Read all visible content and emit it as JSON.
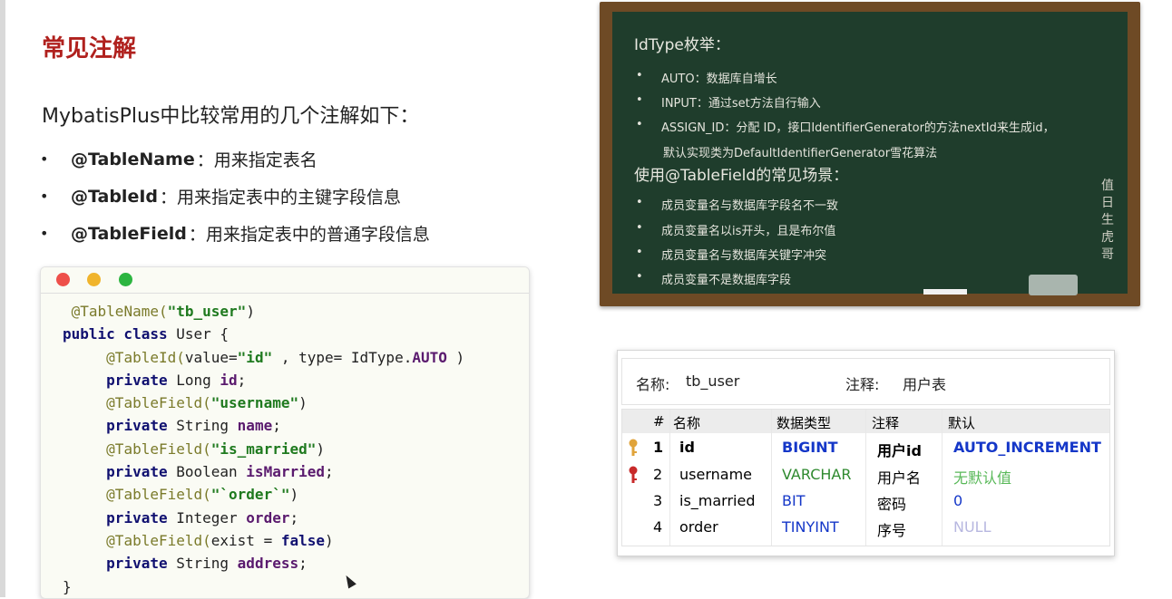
{
  "title": "常见注解",
  "intro": "MybatisPlus中比较常用的几个注解如下：",
  "bullets": [
    {
      "name": "@TableName",
      "desc": "：用来指定表名"
    },
    {
      "name": "@TableId",
      "desc": "：用来指定表中的主键字段信息"
    },
    {
      "name": "@TableField",
      "desc": "：用来指定表中的普通字段信息"
    }
  ],
  "code": {
    "line1": {
      "a": "@TableName(",
      "b": "\"tb_user\"",
      "c": ")"
    },
    "line2": {
      "a": "public class ",
      "b": "User {"
    },
    "line3": {
      "a": "@TableId(",
      "b": "value=",
      "c": "\"id\"",
      "d": " , type= IdType.",
      "e": "AUTO",
      "f": " )"
    },
    "line4": {
      "a": "private ",
      "b": "Long ",
      "c": "id",
      "d": ";"
    },
    "line5": {
      "a": "@TableField(",
      "b": "\"username\"",
      "c": ")"
    },
    "line6": {
      "a": "private ",
      "b": "String ",
      "c": "name",
      "d": ";"
    },
    "line7": {
      "a": "@TableField(",
      "b": "\"is_married\"",
      "c": ")"
    },
    "line8": {
      "a": "private ",
      "b": "Boolean ",
      "c": "isMarried",
      "d": ";"
    },
    "line9": {
      "a": "@TableField(",
      "b": "\"`order`\"",
      "c": ")"
    },
    "line10": {
      "a": "private ",
      "b": "Integer ",
      "c": "order",
      "d": ";"
    },
    "line11": {
      "a": "@TableField(",
      "b": "exist = ",
      "c": "false",
      "d": ")"
    },
    "line12": {
      "a": "private ",
      "b": "String ",
      "c": "address",
      "d": ";"
    },
    "line13": "}"
  },
  "blackboard": {
    "title1": "IdType枚举：",
    "items1": [
      "AUTO：数据库自增长",
      "INPUT：通过set方法自行输入",
      "ASSIGN_ID：分配 ID，接口IdentifierGenerator的方法nextId来生成id，"
    ],
    "item1_cont": "默认实现类为DefaultIdentifierGenerator雪花算法",
    "title2": "使用@TableField的常见场景：",
    "items2": [
      "成员变量名与数据库字段名不一致",
      "成员变量名以is开头，且是布尔值",
      "成员变量名与数据库关键字冲突",
      "成员变量不是数据库字段"
    ],
    "signature": [
      "值",
      "日",
      "生",
      "虎",
      "哥"
    ]
  },
  "db_table": {
    "name_label": "名称:",
    "name_value": "tb_user",
    "comment_label": "注释:",
    "comment_value": "用户表",
    "columns": [
      "#",
      "名称",
      "数据类型",
      "注释",
      "默认"
    ],
    "rows": [
      {
        "num": "1",
        "name": "id",
        "type": "BIGINT",
        "comment": "用户id",
        "default": "AUTO_INCREMENT"
      },
      {
        "num": "2",
        "name": "username",
        "type": "VARCHAR",
        "comment": "用户名",
        "default": "无默认值"
      },
      {
        "num": "3",
        "name": "is_married",
        "type": "BIT",
        "comment": "密码",
        "default": "0"
      },
      {
        "num": "4",
        "name": "order",
        "type": "TINYINT",
        "comment": "序号",
        "default": "NULL"
      }
    ],
    "colors": {
      "key_gold": "#e0a33a",
      "key_red": "#c82a2a",
      "type_blue": "#1537c8",
      "type_green": "#2f8a2f"
    }
  }
}
